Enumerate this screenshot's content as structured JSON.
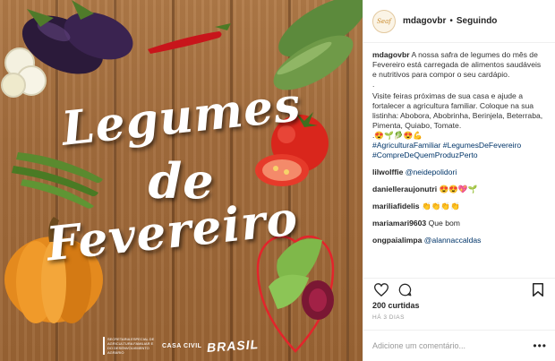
{
  "post": {
    "title_line1": "Legumes",
    "title_line2": "de",
    "title_line3": "Fevereiro",
    "footer_ministry": "Secretaria Especial de Agricultura Familiar e do Desenvolvimento Agrário",
    "footer_casa": "CASA CIVIL",
    "footer_brasil": "BRASIL",
    "colors": {
      "wood": "#a26c3c",
      "heart": "#e3252b",
      "text": "#ffffff"
    }
  },
  "header": {
    "avatar_text": "Seaf",
    "username": "mdagovbr",
    "separator": "•",
    "follow_status": "Seguindo"
  },
  "caption": {
    "username": "mdagovbr",
    "text1": "A nossa safra de legumes do mês de Fevereiro está carregada de alimentos saudáveis e nutritivos para compor o seu cardápio.",
    "text2": ".",
    "text3": "Visite feiras próximas de sua casa e ajude a fortalecer a agricultura familiar. Coloque na sua listinha: Abobora, Abobrinha, Berinjela, Beterraba, Pimenta, Quiabo, Tomate.",
    "emojis": ".😍🌱🥬😍💪",
    "hashtags": "#AgriculturaFamiliar #LegumesDeFevereiro #CompreDeQuemProduzPerto"
  },
  "comments": [
    {
      "user": "lilwolffie",
      "text": "@neidepolidori",
      "is_mention": true
    },
    {
      "user": "danielleraujonutri",
      "text": "😍😍💖🌱",
      "is_mention": false
    },
    {
      "user": "mariliafidelis",
      "text": "👏👏👏👏",
      "is_mention": false
    },
    {
      "user": "mariamari9603",
      "text": "Que bom",
      "is_mention": false
    },
    {
      "user": "ongpaialimpa",
      "text": "@alannaccaldas",
      "is_mention": true
    }
  ],
  "actions": {
    "likes": "200 curtidas",
    "timestamp": "HÁ 3 DIAS"
  },
  "add_comment": {
    "placeholder": "Adicione um comentário...",
    "more": "•••"
  }
}
